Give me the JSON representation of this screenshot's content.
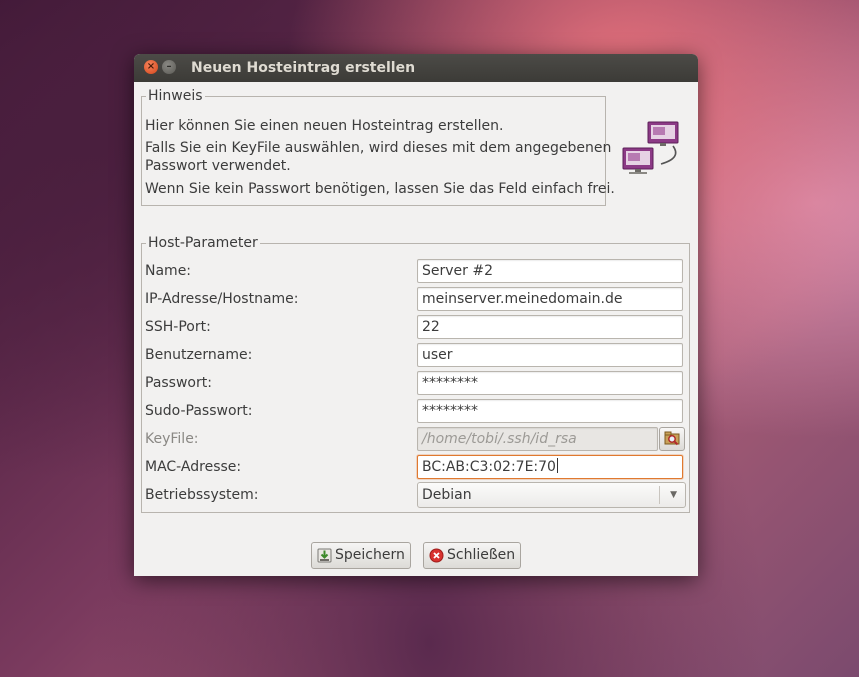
{
  "window": {
    "title": "Neuen Hosteintrag erstellen"
  },
  "hint": {
    "legend": "Hinweis",
    "lines": [
      "Hier können Sie einen neuen Hosteintrag erstellen.",
      "Falls Sie ein KeyFile auswählen, wird dieses mit dem angegebenen",
      "Passwort verwendet.",
      "Wenn Sie kein Passwort benötigen, lassen Sie das Feld einfach frei."
    ],
    "icon": "network-computers-icon"
  },
  "params": {
    "legend": "Host-Parameter",
    "name": {
      "label": "Name:",
      "value": "Server #2"
    },
    "host": {
      "label": "IP-Adresse/Hostname:",
      "value": "meinserver.meinedomain.de"
    },
    "port": {
      "label": "SSH-Port:",
      "value": "22"
    },
    "user": {
      "label": "Benutzername:",
      "value": "user"
    },
    "password": {
      "label": "Passwort:",
      "value": "********"
    },
    "sudo": {
      "label": "Sudo-Passwort:",
      "value": "********"
    },
    "keyfile": {
      "label": "KeyFile:",
      "value": "/home/tobi/.ssh/id_rsa"
    },
    "mac": {
      "label": "MAC-Adresse:",
      "value": "BC:AB:C3:02:7E:70"
    },
    "os": {
      "label": "Betriebssystem:",
      "value": "Debian"
    }
  },
  "buttons": {
    "save": "Speichern",
    "close": "Schließen"
  },
  "colors": {
    "focus": "#e0792f",
    "titlebar": "#3c3b37",
    "window_bg": "#f2f1f0"
  }
}
